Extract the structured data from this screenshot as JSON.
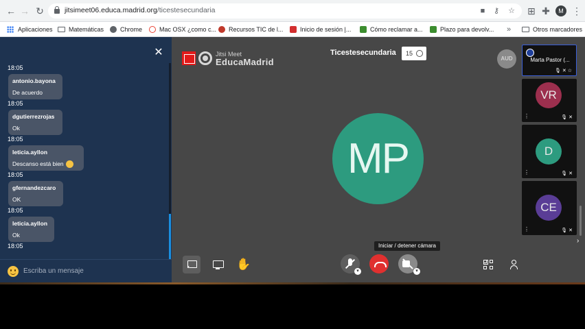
{
  "browser": {
    "url_host": "jitsimeet06.educa.madrid.org",
    "url_path": "/ticestesecundaria",
    "profile_initial": "M",
    "bookmarks": [
      {
        "label": "Aplicaciones",
        "icon": "apps-grid-icon"
      },
      {
        "label": "Matemáticas",
        "icon": "folder-icon"
      },
      {
        "label": "Chrome",
        "icon": "chrome-icon"
      },
      {
        "label": "Mac OSX ¿como c...",
        "icon": "google-icon"
      },
      {
        "label": "Recursos TIC de l...",
        "icon": "site-icon"
      },
      {
        "label": "Inicio de sesión |...",
        "icon": "site-icon"
      },
      {
        "label": "Cómo reclamar a...",
        "icon": "site-icon"
      },
      {
        "label": "Plazo para devolv...",
        "icon": "site-icon"
      }
    ],
    "bookmarks_overflow": "»",
    "other_bookmarks": "Otros marcadores"
  },
  "chat": {
    "messages": [
      {
        "time": "18:05"
      },
      {
        "sender": "antonio.bayona",
        "text": "De acuerdo",
        "time": "18:05"
      },
      {
        "sender": "dgutierrezrojas",
        "text": "Ok",
        "time": "18:05"
      },
      {
        "sender": "leticia.ayllon",
        "text": "Descanso está bien",
        "time": "18:05"
      },
      {
        "sender": "gfernandezcaro",
        "text": "OK",
        "time": "18:05"
      },
      {
        "sender": "leticia.ayllon",
        "text": "Ok",
        "time": "18:05"
      }
    ],
    "input_placeholder": "Escriba un mensaje",
    "close_glyph": "✕"
  },
  "meeting": {
    "logo_line1": "Jitsi Meet",
    "logo_line2": "EducaMadrid",
    "room_name": "Ticestesecundaria",
    "participant_count": "15",
    "audio_only_badge": "AUD",
    "main_initials": "MP",
    "tooltip": "Iniciar / detener cámara"
  },
  "filmstrip": [
    {
      "name": "Marta Pastor (...",
      "initials": "",
      "color": "#111111",
      "active": true
    },
    {
      "name": "",
      "initials": "VR",
      "color": "#9c2f4e",
      "active": false
    },
    {
      "name": "",
      "initials": "D",
      "color": "#2d9b7f",
      "active": false
    },
    {
      "name": "",
      "initials": "CE",
      "color": "#5a3d96",
      "active": false
    }
  ],
  "colors": {
    "chat_bg": "#1e3350",
    "stage_bg": "#474747",
    "hangup": "#e0302f",
    "main_avatar": "#2d9b7f",
    "accent": "#1a8fe0"
  }
}
